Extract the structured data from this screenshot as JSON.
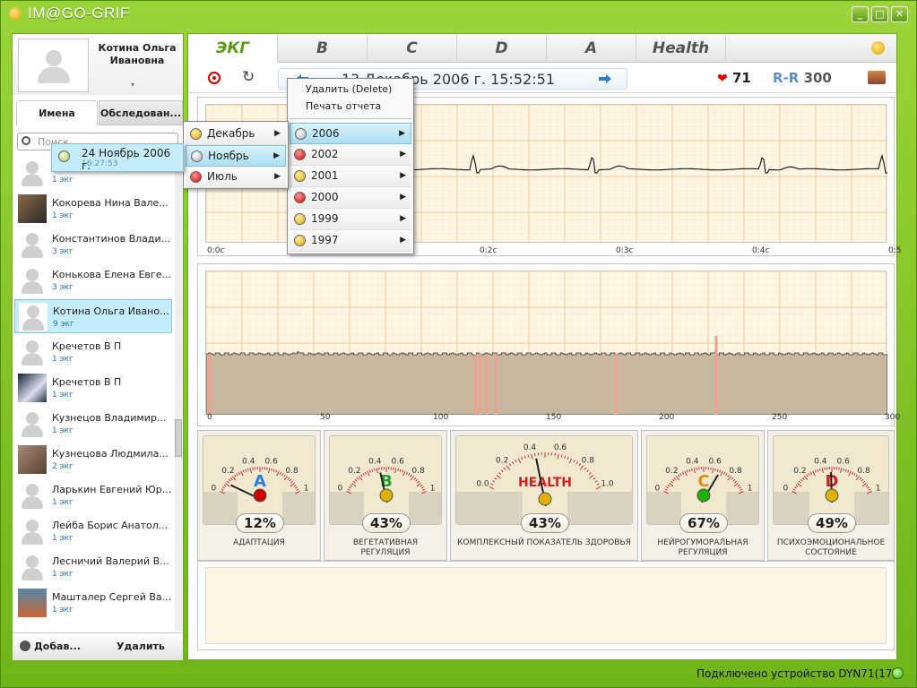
{
  "app": {
    "title": "IM@GO-GRIF"
  },
  "profile": {
    "name": "Котина Ольга Ивановна"
  },
  "left_tabs": {
    "names": "Имена",
    "exams": "Обследован..."
  },
  "search": {
    "placeholder": "Поиск"
  },
  "patients": [
    {
      "name": "",
      "count": "1 экг"
    },
    {
      "name": "Кокорева Нина Вале...",
      "count": "1 экг"
    },
    {
      "name": "Константинов Влади...",
      "count": "3 экг"
    },
    {
      "name": "Конькова Елена Евге...",
      "count": "3 экг"
    },
    {
      "name": "Котина Ольга Ивано...",
      "count": "9 экг"
    },
    {
      "name": "Кречетов В П",
      "count": "1 экг"
    },
    {
      "name": "Кречетов В П",
      "count": "1 экг"
    },
    {
      "name": "Кузнецов Владимир...",
      "count": "1 экг"
    },
    {
      "name": "Кузнецова Людмила...",
      "count": "2 экг"
    },
    {
      "name": "Ларькин Евгений Юр...",
      "count": "1 экг"
    },
    {
      "name": "Лейба Борис Анатол...",
      "count": "1 экг"
    },
    {
      "name": "Лесничий Валерий В...",
      "count": "1 экг"
    },
    {
      "name": "Машталер Сергей Ва...",
      "count": "1 экг"
    }
  ],
  "left_bottom": {
    "add": "Добав...",
    "delete": "Удалить"
  },
  "main_tabs": [
    "ЭКГ",
    "B",
    "C",
    "D",
    "A",
    "Health"
  ],
  "header": {
    "datetime": "13 Декабрь 2006 г. 15:52:51",
    "heart_rate": "71",
    "rr_label": "R-R",
    "rr_value": "300"
  },
  "ecg_axis": [
    "0:0c",
    "0:1c",
    "0:2c",
    "0:3c",
    "0:4c",
    "0:5"
  ],
  "rr_axis": [
    "0",
    "50",
    "100",
    "150",
    "200",
    "250",
    "300"
  ],
  "gauges": [
    {
      "letter": "A",
      "percent": "12%",
      "caption": "АДАПТАЦИЯ",
      "value": 0.12,
      "led": "red",
      "letter_color": "#2b7fd0"
    },
    {
      "letter": "B",
      "percent": "43%",
      "caption": "ВЕГЕТАТИВНАЯ РЕГУЛЯЦИЯ",
      "value": 0.43,
      "led": "yellow",
      "letter_color": "#2a9a2a"
    },
    {
      "letter": "HEALTH",
      "percent": "43%",
      "caption": "КОМПЛЕКСНЫЙ ПОКАЗАТЕЛЬ ЗДОРОВЬЯ",
      "value": 0.43,
      "led": "yellow",
      "letter_color": "#cc2222"
    },
    {
      "letter": "C",
      "percent": "67%",
      "caption": "НЕЙРОГУМОРАЛЬНАЯ РЕГУЛЯЦИЯ",
      "value": 0.67,
      "led": "green",
      "letter_color": "#e08a10"
    },
    {
      "letter": "D",
      "percent": "49%",
      "caption": "ПСИХОЭМОЦИОНАЛЬНОЕ СОСТОЯНИЕ",
      "value": 0.49,
      "led": "yellow",
      "letter_color": "#cc2222"
    }
  ],
  "gauge_scale": [
    "0",
    "0.2",
    "0.4",
    "0.6",
    "0.8",
    "1"
  ],
  "health_scale": [
    "0.0",
    "0.2",
    "0.4",
    "0.6",
    "0.8",
    "1.0"
  ],
  "context_menu": {
    "delete": "Удалить (Delete)",
    "print": "Печать отчета"
  },
  "years": [
    {
      "label": "2006",
      "led": "gray"
    },
    {
      "label": "2002",
      "led": "red"
    },
    {
      "label": "2001",
      "led": "yellow"
    },
    {
      "label": "2000",
      "led": "red"
    },
    {
      "label": "1999",
      "led": "yellow"
    },
    {
      "label": "1997",
      "led": "yellow"
    }
  ],
  "months": [
    {
      "label": "Декабрь",
      "led": "yellow"
    },
    {
      "label": "Ноябрь",
      "led": "gray"
    },
    {
      "label": "Июль",
      "led": "red"
    }
  ],
  "day_item": {
    "label": "24 Ноябрь 2006 г.",
    "time": "16:27:53"
  },
  "status": {
    "text": "Подключено устройство DYN71(17)"
  }
}
